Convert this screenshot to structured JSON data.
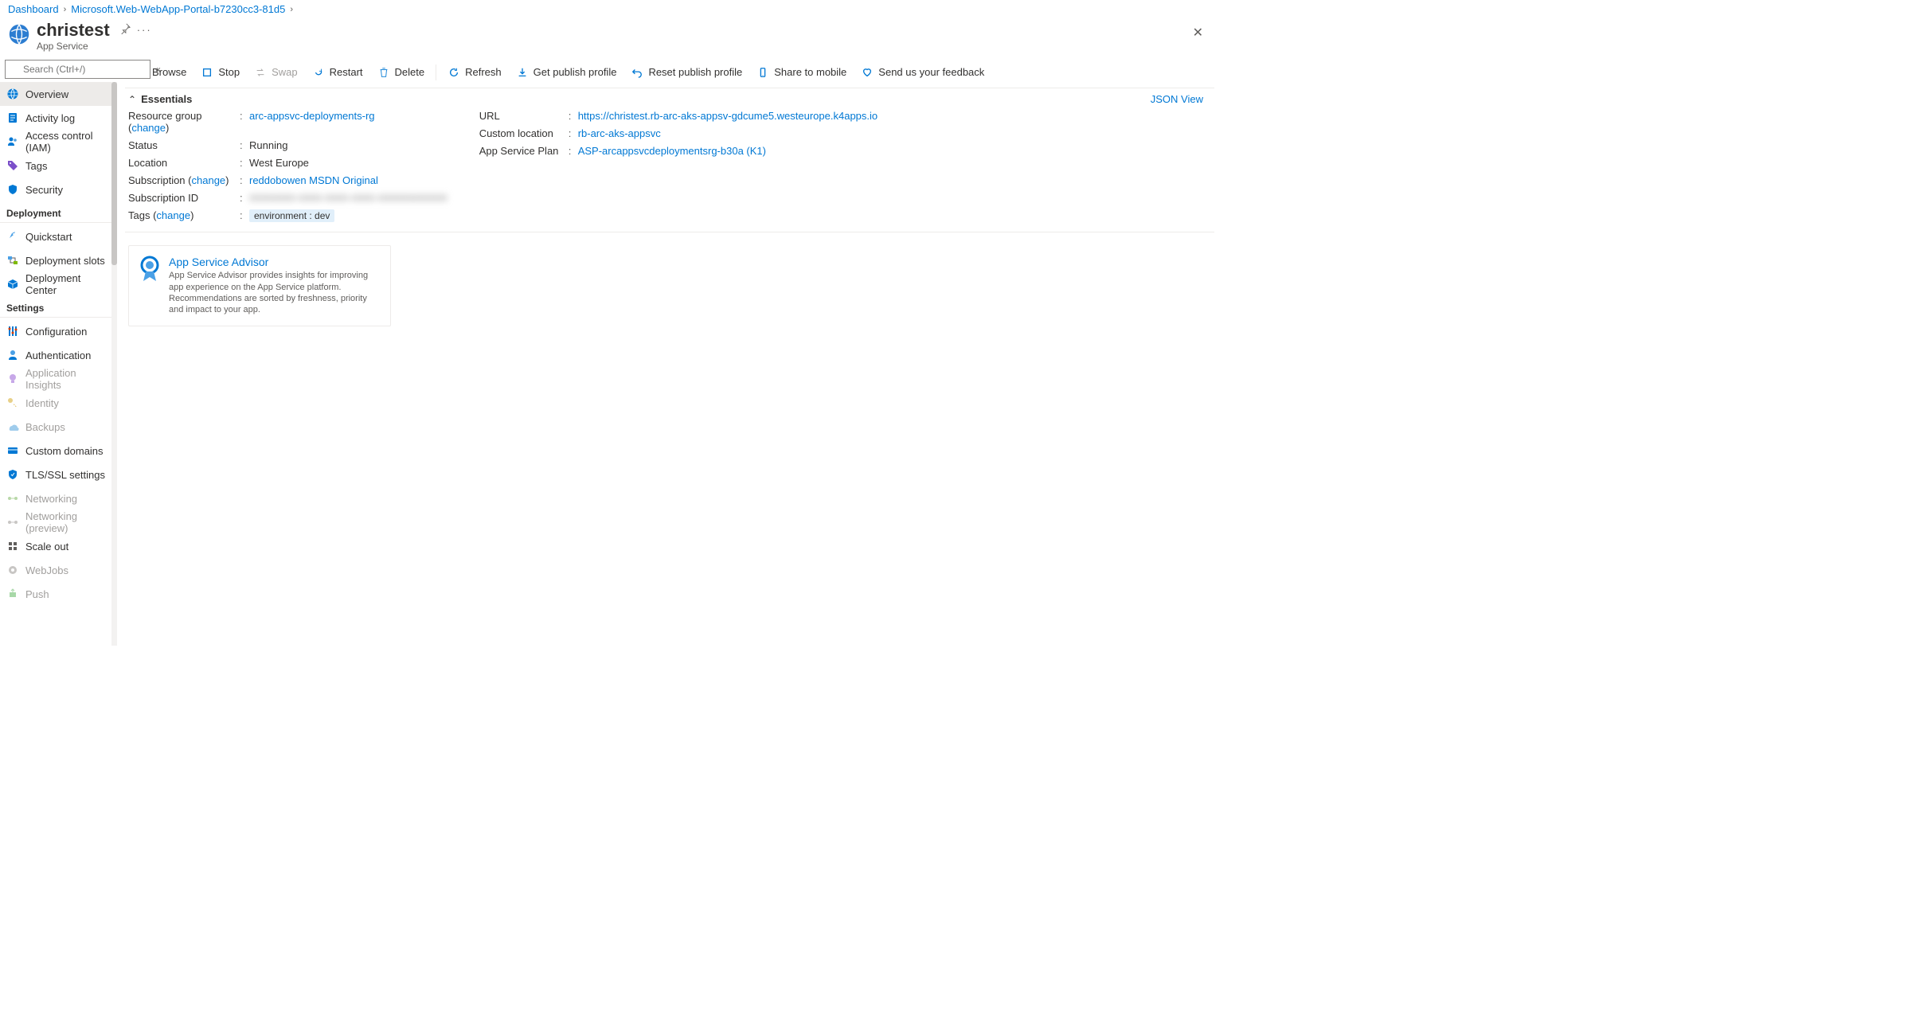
{
  "breadcrumb": {
    "items": [
      "Dashboard",
      "Microsoft.Web-WebApp-Portal-b7230cc3-81d5"
    ]
  },
  "header": {
    "title": "christest",
    "subtitle": "App Service"
  },
  "sidebar": {
    "search_placeholder": "Search (Ctrl+/)",
    "items": [
      {
        "label": "Overview",
        "active": true
      },
      {
        "label": "Activity log"
      },
      {
        "label": "Access control (IAM)"
      },
      {
        "label": "Tags"
      },
      {
        "label": "Security"
      }
    ],
    "groups": [
      {
        "title": "Deployment",
        "items": [
          {
            "label": "Quickstart"
          },
          {
            "label": "Deployment slots"
          },
          {
            "label": "Deployment Center"
          }
        ]
      },
      {
        "title": "Settings",
        "items": [
          {
            "label": "Configuration"
          },
          {
            "label": "Authentication"
          },
          {
            "label": "Application Insights",
            "disabled": true
          },
          {
            "label": "Identity",
            "disabled": true
          },
          {
            "label": "Backups",
            "disabled": true
          },
          {
            "label": "Custom domains"
          },
          {
            "label": "TLS/SSL settings"
          },
          {
            "label": "Networking",
            "disabled": true
          },
          {
            "label": "Networking (preview)",
            "disabled": true
          },
          {
            "label": "Scale out"
          },
          {
            "label": "WebJobs",
            "disabled": true
          },
          {
            "label": "Push",
            "disabled": true
          }
        ]
      }
    ]
  },
  "toolbar": {
    "browse": "Browse",
    "stop": "Stop",
    "swap": "Swap",
    "restart": "Restart",
    "delete": "Delete",
    "refresh": "Refresh",
    "getpub": "Get publish profile",
    "resetpub": "Reset publish profile",
    "share": "Share to mobile",
    "feedback": "Send us your feedback"
  },
  "essentials": {
    "label": "Essentials",
    "json_view": "JSON View",
    "left": {
      "rg_key": "Resource group",
      "rg_change": "change",
      "rg_val": "arc-appsvc-deployments-rg",
      "status_key": "Status",
      "status_val": "Running",
      "loc_key": "Location",
      "loc_val": "West Europe",
      "sub_key": "Subscription",
      "sub_change": "change",
      "sub_val": "reddobowen MSDN Original",
      "subid_key": "Subscription ID",
      "subid_val": "00000000-0000-0000-0000-000000000000",
      "tags_key": "Tags",
      "tags_change": "change",
      "tag_chip": "environment : dev"
    },
    "right": {
      "url_key": "URL",
      "url_val": "https://christest.rb-arc-aks-appsv-gdcume5.westeurope.k4apps.io",
      "cloc_key": "Custom location",
      "cloc_val": "rb-arc-aks-appsvc",
      "plan_key": "App Service Plan",
      "plan_val": "ASP-arcappsvcdeploymentsrg-b30a (K1)"
    }
  },
  "advisor": {
    "title": "App Service Advisor",
    "desc": "App Service Advisor provides insights for improving app experience on the App Service platform. Recommendations are sorted by freshness, priority and impact to your app."
  }
}
